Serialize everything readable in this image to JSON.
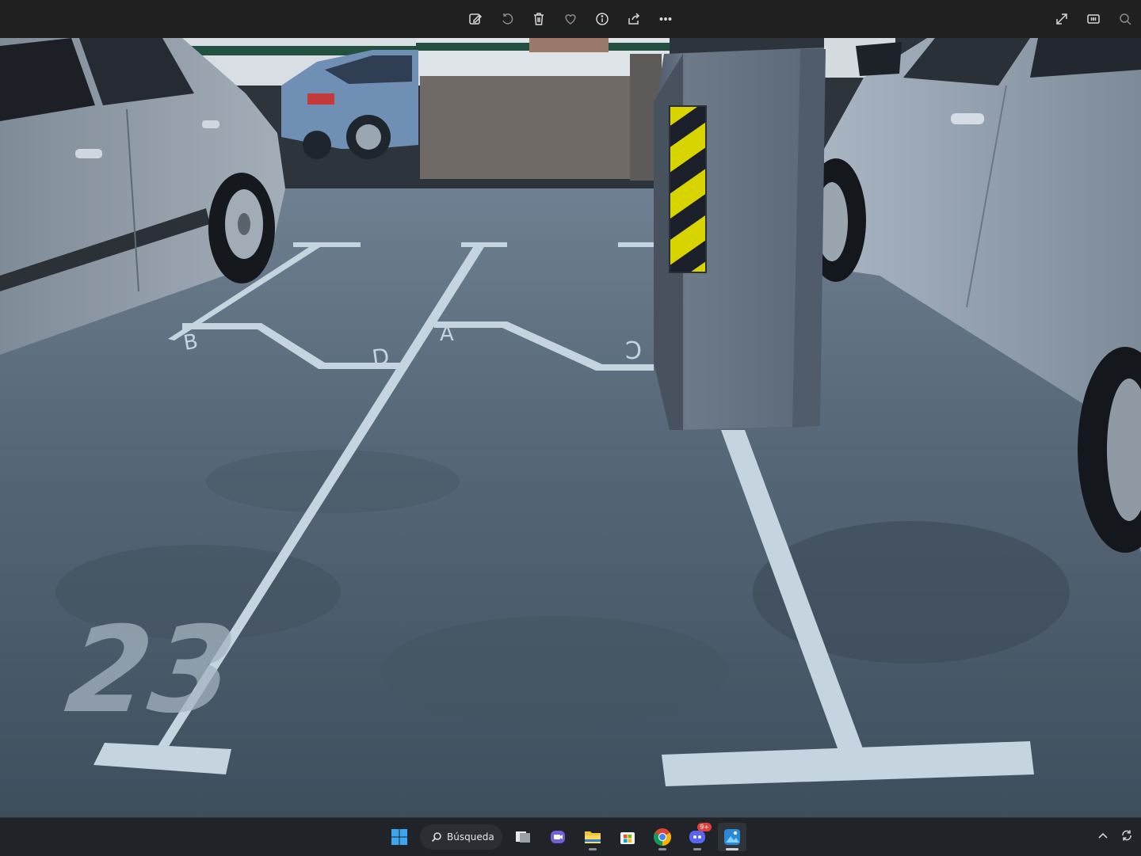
{
  "toolbar": {
    "buttons": [
      {
        "name": "edit-image-button",
        "icon": "edit-image-icon"
      },
      {
        "name": "rotate-button",
        "icon": "rotate-icon"
      },
      {
        "name": "delete-button",
        "icon": "trash-icon"
      },
      {
        "name": "favorite-button",
        "icon": "heart-icon"
      },
      {
        "name": "info-button",
        "icon": "info-icon"
      },
      {
        "name": "share-button",
        "icon": "share-icon"
      },
      {
        "name": "more-button",
        "icon": "more-icon"
      }
    ],
    "right_buttons": [
      {
        "name": "fullscreen-button",
        "icon": "expand-icon"
      },
      {
        "name": "actual-size-button",
        "icon": "actual-size-icon"
      },
      {
        "name": "zoom-button",
        "icon": "zoom-icon"
      }
    ]
  },
  "photo": {
    "floor_letters": [
      "B",
      "D",
      "A",
      "C"
    ],
    "space_number": "23"
  },
  "taskbar": {
    "search_label": "Búsqueda",
    "discord_badge": "9+",
    "apps": [
      "start-icon",
      "search-icon",
      "task-view-icon",
      "teams-icon",
      "file-explorer-icon",
      "store-icon",
      "chrome-icon",
      "discord-icon",
      "photos-icon"
    ],
    "tray": [
      "chevron-up-icon",
      "sync-icon"
    ]
  }
}
